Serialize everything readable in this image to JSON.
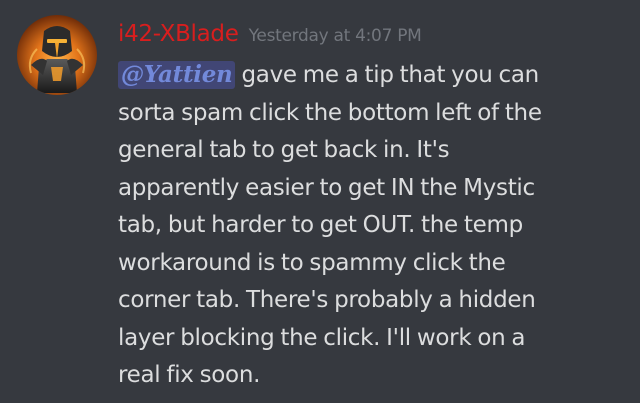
{
  "message": {
    "author": {
      "username": "i42-XBlade",
      "avatar_icon": "armored-knight-avatar-icon",
      "name_color": "#d81e1e"
    },
    "timestamp": "Yesterday at 4:07 PM",
    "mention": "@Yattien",
    "lines": [
      "gave me a tip that you can",
      "sorta spam click the bottom left of the",
      "general tab to get back in. It's",
      "apparently easier to get IN the Mystic",
      "tab, but harder to get OUT. the temp",
      "workaround is to spammy click the",
      "corner tab. There's probably a hidden",
      "layer blocking the click. I'll work on a",
      "real fix soon."
    ]
  },
  "colors": {
    "background": "#36393f",
    "message_text": "#dcddde",
    "timestamp": "#72767d",
    "mention_text": "#7289da",
    "mention_background": "#414675"
  }
}
